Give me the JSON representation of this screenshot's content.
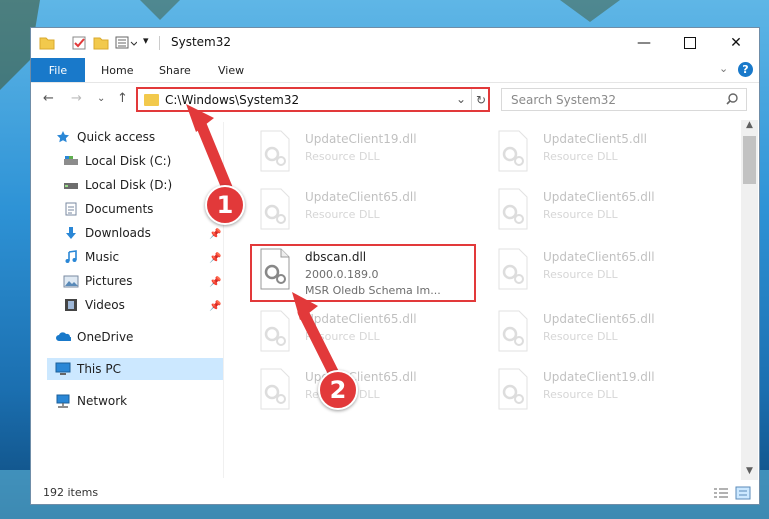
{
  "window": {
    "title": "System32"
  },
  "ribbon": {
    "file": "File",
    "home": "Home",
    "share": "Share",
    "view": "View",
    "help": "?"
  },
  "nav": {
    "address": "C:\\Windows\\System32",
    "search_placeholder": "Search System32"
  },
  "sidebar": {
    "quick_access": "Quick access",
    "items": [
      {
        "label": "Local Disk (C:)",
        "icon": "drive-icon",
        "pinned": false
      },
      {
        "label": "Local Disk (D:)",
        "icon": "drive-icon",
        "pinned": false
      },
      {
        "label": "Documents",
        "icon": "documents-icon",
        "pinned": false
      },
      {
        "label": "Downloads",
        "icon": "downloads-icon",
        "pinned": true
      },
      {
        "label": "Music",
        "icon": "music-icon",
        "pinned": true
      },
      {
        "label": "Pictures",
        "icon": "pictures-icon",
        "pinned": true
      },
      {
        "label": "Videos",
        "icon": "videos-icon",
        "pinned": true
      }
    ],
    "onedrive": "OneDrive",
    "this_pc": "This PC",
    "network": "Network"
  },
  "files": [
    {
      "name": "UpdateClient19.dll",
      "desc": "Resource DLL",
      "faded": true
    },
    {
      "name": "UpdateClient5.dll",
      "desc": "Resource DLL",
      "faded": true
    },
    {
      "name": "UpdateClient65.dll",
      "desc": "Resource DLL",
      "faded": true
    },
    {
      "name": "UpdateClient65.dll",
      "desc": "Resource DLL",
      "faded": true
    },
    {
      "name": "dbscan.dll",
      "desc": "2000.0.189.0",
      "desc2": "MSR Oledb Schema Im...",
      "faded": false
    },
    {
      "name": "UpdateClient65.dll",
      "desc": "Resource DLL",
      "faded": true
    },
    {
      "name": "UpdateClient65.dll",
      "desc": "Resource DLL",
      "faded": true
    },
    {
      "name": "UpdateClient65.dll",
      "desc": "Resource DLL",
      "faded": true
    },
    {
      "name": "UpdateClient65.dll",
      "desc": "Resource DLL",
      "faded": true
    },
    {
      "name": "UpdateClient19.dll",
      "desc": "Resource DLL",
      "faded": true
    }
  ],
  "status": {
    "count": "192 items"
  },
  "callouts": {
    "one": "1",
    "two": "2"
  },
  "colors": {
    "accent": "#1979ca",
    "highlight": "#e2393a",
    "selected": "#cce8ff"
  }
}
